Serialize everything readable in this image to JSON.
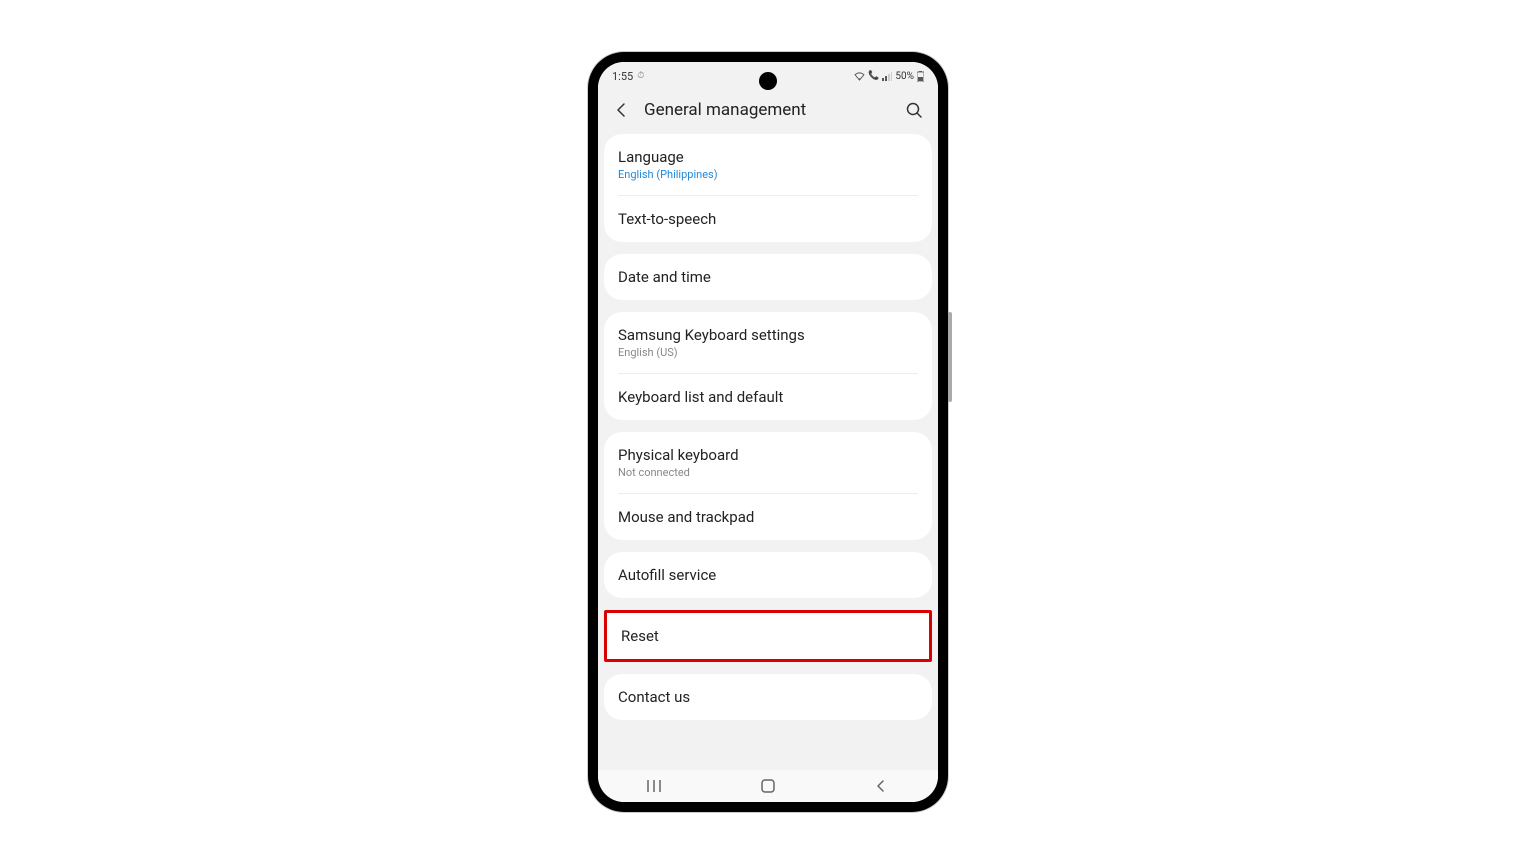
{
  "status": {
    "time": "1:55",
    "alarm_icon": "⏰",
    "battery": "50%"
  },
  "header": {
    "title": "General management"
  },
  "groups": [
    {
      "rows": [
        {
          "title": "Language",
          "sub": "English (Philippines)",
          "subStyle": "blue"
        },
        {
          "title": "Text-to-speech"
        }
      ]
    },
    {
      "rows": [
        {
          "title": "Date and time"
        }
      ]
    },
    {
      "rows": [
        {
          "title": "Samsung Keyboard settings",
          "sub": "English (US)",
          "subStyle": "gray"
        },
        {
          "title": "Keyboard list and default"
        }
      ]
    },
    {
      "rows": [
        {
          "title": "Physical keyboard",
          "sub": "Not connected",
          "subStyle": "gray"
        },
        {
          "title": "Mouse and trackpad"
        }
      ]
    },
    {
      "rows": [
        {
          "title": "Autofill service"
        }
      ]
    },
    {
      "highlight": true,
      "rows": [
        {
          "title": "Reset"
        }
      ]
    },
    {
      "rows": [
        {
          "title": "Contact us"
        }
      ]
    }
  ]
}
